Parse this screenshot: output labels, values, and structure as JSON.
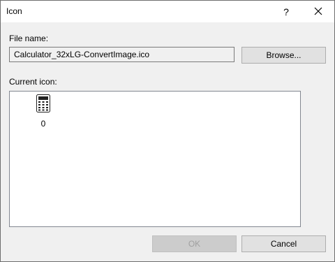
{
  "window": {
    "title": "Icon",
    "help_glyph": "?",
    "close_glyph": "✕"
  },
  "file": {
    "label": "File name:",
    "value": "Calculator_32xLG-ConvertImage.ico",
    "browse_label": "Browse..."
  },
  "icons": {
    "label": "Current icon:",
    "items": [
      {
        "icon": "calculator-icon",
        "caption": "0"
      }
    ]
  },
  "footer": {
    "ok_label": "OK",
    "ok_enabled": false,
    "cancel_label": "Cancel"
  }
}
